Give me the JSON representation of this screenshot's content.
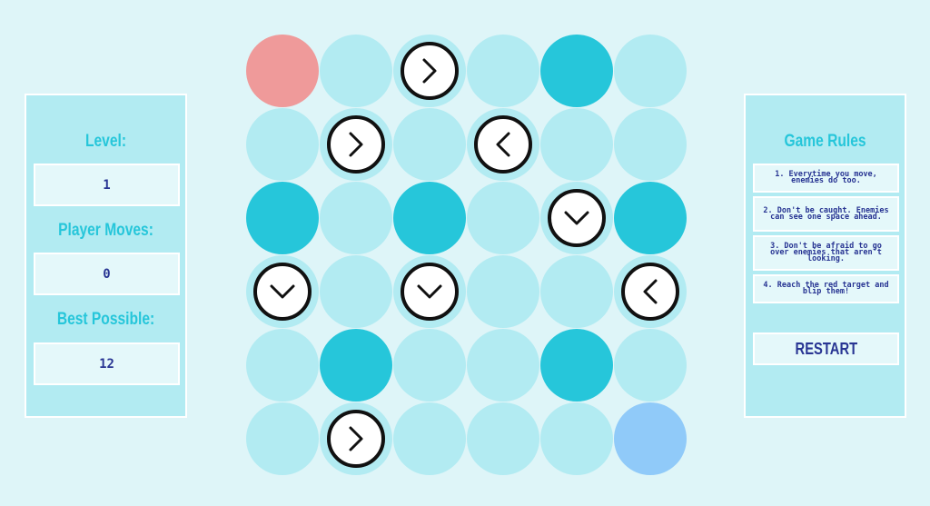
{
  "stats": {
    "level_label": "Level:",
    "level_value": "1",
    "moves_label": "Player Moves:",
    "moves_value": "0",
    "best_label": "Best Possible:",
    "best_value": "12"
  },
  "rules": {
    "title": "Game Rules",
    "items": [
      "1. Everytime you move, enemies do too.",
      "2. Don't be caught. Enemies can see one space ahead.",
      "3. Don't be afraid to go over enemies that aren't looking.",
      "4. Reach the red target and blip them!"
    ],
    "restart_label": "RESTART"
  },
  "colors": {
    "floor": "#b2ebf2",
    "wall": "#26c6da",
    "target": "#ef9a9a",
    "player": "#90caf9",
    "accent": "#26c6da",
    "text": "#283593"
  },
  "board": {
    "rows": 6,
    "cols": 6,
    "cells": [
      {
        "type": "target"
      },
      {
        "type": "floor"
      },
      {
        "type": "floor",
        "enemy": "right"
      },
      {
        "type": "floor"
      },
      {
        "type": "wall"
      },
      {
        "type": "floor"
      },
      {
        "type": "floor"
      },
      {
        "type": "floor",
        "enemy": "right"
      },
      {
        "type": "floor"
      },
      {
        "type": "floor",
        "enemy": "left"
      },
      {
        "type": "floor"
      },
      {
        "type": "floor"
      },
      {
        "type": "wall"
      },
      {
        "type": "floor"
      },
      {
        "type": "wall"
      },
      {
        "type": "floor"
      },
      {
        "type": "floor",
        "enemy": "down"
      },
      {
        "type": "wall"
      },
      {
        "type": "floor",
        "enemy": "down"
      },
      {
        "type": "floor"
      },
      {
        "type": "floor",
        "enemy": "down"
      },
      {
        "type": "floor"
      },
      {
        "type": "floor"
      },
      {
        "type": "floor",
        "enemy": "left"
      },
      {
        "type": "floor"
      },
      {
        "type": "wall"
      },
      {
        "type": "floor"
      },
      {
        "type": "floor"
      },
      {
        "type": "wall"
      },
      {
        "type": "floor"
      },
      {
        "type": "floor"
      },
      {
        "type": "floor",
        "enemy": "right"
      },
      {
        "type": "floor"
      },
      {
        "type": "floor"
      },
      {
        "type": "floor"
      },
      {
        "type": "player"
      }
    ]
  }
}
